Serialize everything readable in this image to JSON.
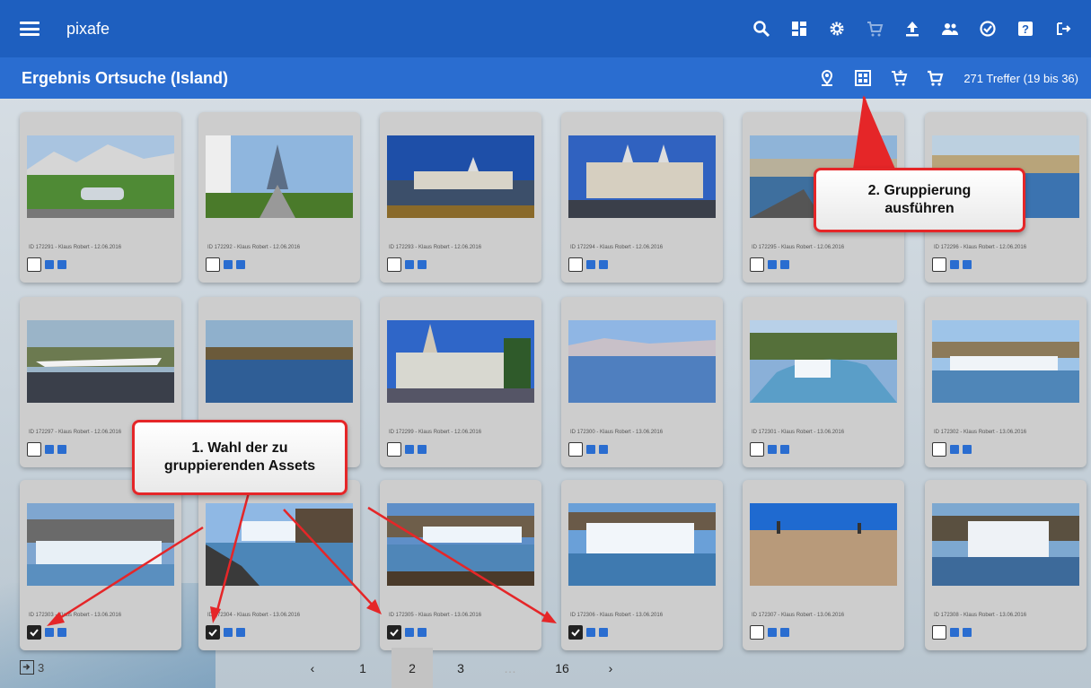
{
  "app": {
    "title": "pixafe"
  },
  "header": {
    "page_title": "Ergebnis Ortsuche (Island)",
    "hits": "271 Treffer (19 bis 36)",
    "top_icons": [
      "search-icon",
      "dashboard-icon",
      "settings-icon",
      "cart-icon",
      "upload-icon",
      "users-icon",
      "check-circle-icon",
      "help-icon",
      "logout-icon"
    ],
    "sub_icons": [
      "location-icon",
      "group-icon",
      "cart-add-icon",
      "cart-icon"
    ]
  },
  "assets": [
    {
      "caption": "ID 172291 - Klaus Robert - 12.06.2016",
      "checked": false
    },
    {
      "caption": "ID 172292 - Klaus Robert - 12.06.2016",
      "checked": false
    },
    {
      "caption": "ID 172293 - Klaus Robert - 12.06.2016",
      "checked": false
    },
    {
      "caption": "ID 172294 - Klaus Robert - 12.06.2016",
      "checked": false
    },
    {
      "caption": "ID 172295 - Klaus Robert - 12.06.2016",
      "checked": false
    },
    {
      "caption": "ID 172296 - Klaus Robert - 12.06.2016",
      "checked": false
    },
    {
      "caption": "ID 172297 - Klaus Robert - 12.06.2016",
      "checked": false
    },
    {
      "caption": "ID 172298 - Klaus Robert - 12.06.2016",
      "checked": false
    },
    {
      "caption": "ID 172299 - Klaus Robert - 12.06.2016",
      "checked": false
    },
    {
      "caption": "ID 172300 - Klaus Robert - 13.06.2016",
      "checked": false
    },
    {
      "caption": "ID 172301 - Klaus Robert - 13.06.2016",
      "checked": false
    },
    {
      "caption": "ID 172302 - Klaus Robert - 13.06.2016",
      "checked": false
    },
    {
      "caption": "ID 172303 - Klaus Robert - 13.06.2016",
      "checked": true
    },
    {
      "caption": "ID 172304 - Klaus Robert - 13.06.2016",
      "checked": true
    },
    {
      "caption": "ID 172305 - Klaus Robert - 13.06.2016",
      "checked": true
    },
    {
      "caption": "ID 172306 - Klaus Robert - 13.06.2016",
      "checked": true
    },
    {
      "caption": "ID 172307 - Klaus Robert - 13.06.2016",
      "checked": false
    },
    {
      "caption": "ID 172308 - Klaus Robert - 13.06.2016",
      "checked": false
    }
  ],
  "pagination": {
    "prev": "‹",
    "pages": [
      "1",
      "2",
      "3",
      "…",
      "16"
    ],
    "active": "2",
    "next": "›"
  },
  "footer": {
    "count": "3"
  },
  "annotations": {
    "step1": "1. Wahl der zu gruppierenden Assets",
    "step1_line1": "1. Wahl der zu",
    "step1_line2": "gruppierenden Assets",
    "step2_line1": "2. Gruppierung",
    "step2_line2": "ausführen"
  },
  "colors": {
    "primary": "#1e5fbf",
    "secondary": "#2a6dd0",
    "callout_border": "#e52628",
    "card": "#cdcdcd"
  }
}
